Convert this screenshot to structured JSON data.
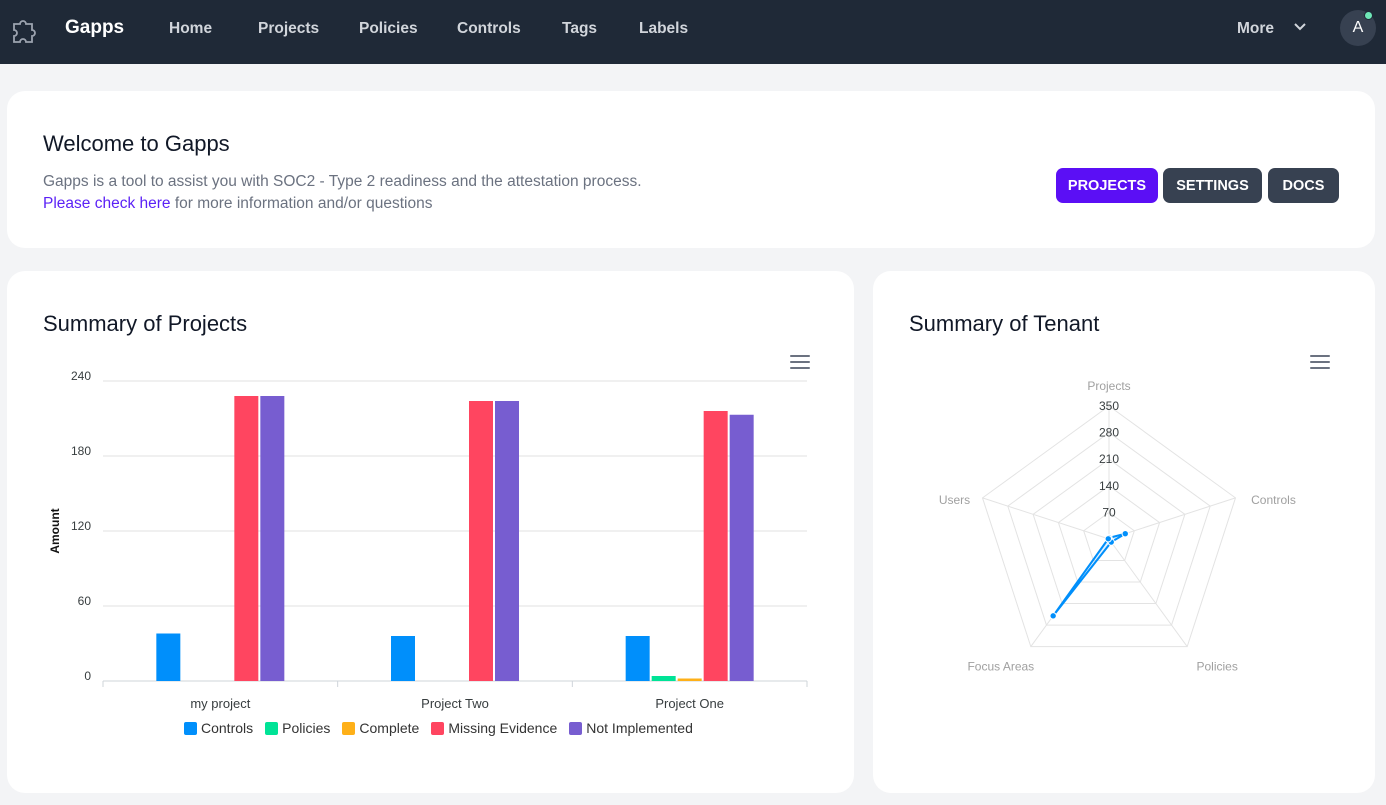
{
  "nav": {
    "brand": "Gapps",
    "links": [
      "Home",
      "Projects",
      "Policies",
      "Controls",
      "Tags",
      "Labels"
    ],
    "more": "More",
    "avatar_initial": "A"
  },
  "welcome": {
    "title": "Welcome to Gapps",
    "line1": "Gapps is a tool to assist you with SOC2 - Type 2 readiness and the attestation process.",
    "link_text": "Please check here",
    "line2_rest": " for more information and/or questions",
    "buttons": {
      "projects": "PROJECTS",
      "settings": "SETTINGS",
      "docs": "DOCS"
    }
  },
  "projects_card": {
    "title": "Summary of Projects"
  },
  "tenant_card": {
    "title": "Summary of Tenant"
  },
  "colors": {
    "controls": "#008ffb",
    "policies": "#00e396",
    "complete": "#feb019",
    "missing": "#ff4560",
    "not_implemented": "#775dd0",
    "primary": "#5b0ff5"
  },
  "chart_data": [
    {
      "type": "bar",
      "categories": [
        "my project",
        "Project Two",
        "Project One"
      ],
      "series": [
        {
          "name": "Controls",
          "values": [
            38,
            36,
            36
          ]
        },
        {
          "name": "Policies",
          "values": [
            0,
            0,
            4
          ]
        },
        {
          "name": "Complete",
          "values": [
            0,
            0,
            2
          ]
        },
        {
          "name": "Missing Evidence",
          "values": [
            228,
            224,
            216
          ]
        },
        {
          "name": "Not Implemented",
          "values": [
            228,
            224,
            213
          ]
        }
      ],
      "ylabel": "Amount",
      "ylim": [
        0,
        240
      ],
      "yticks": [
        "0",
        "60",
        "120",
        "180",
        "240"
      ],
      "grid": true,
      "legend": "bottom"
    },
    {
      "type": "radar",
      "categories": [
        "Projects",
        "Controls",
        "Policies",
        "Focus Areas",
        "Users"
      ],
      "series": [
        {
          "values": [
            3,
            45,
            10,
            250,
            2
          ]
        }
      ],
      "rlim": [
        0,
        350
      ],
      "rticks": [
        "70",
        "140",
        "210",
        "280",
        "350"
      ]
    }
  ]
}
